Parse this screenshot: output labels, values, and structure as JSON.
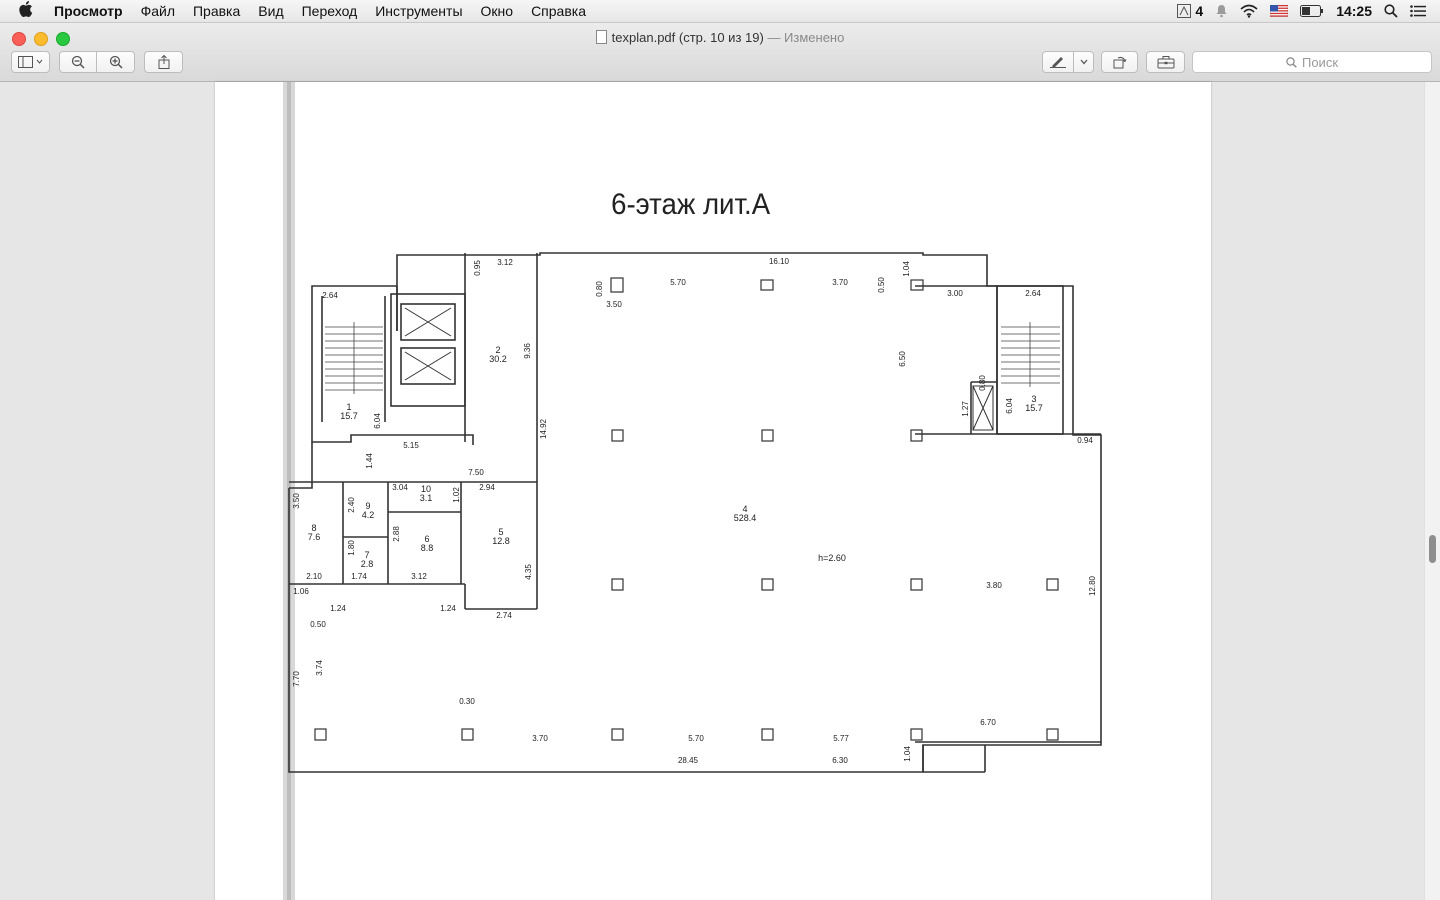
{
  "menubar": {
    "apple_label": "",
    "app_name": "Просмотр",
    "items": [
      "Файл",
      "Правка",
      "Вид",
      "Переход",
      "Инструменты",
      "Окно",
      "Справка"
    ],
    "status_count": "4",
    "clock": "14:25"
  },
  "window": {
    "filename": "texplan.pdf (стр. 10 из 19)",
    "status": "— Изменено",
    "search_placeholder": "Поиск"
  },
  "plan": {
    "title": "6-этаж лит.А",
    "rooms": [
      {
        "num": "1",
        "area": "15.7"
      },
      {
        "num": "2",
        "area": "30.2"
      },
      {
        "num": "3",
        "area": "15.7"
      },
      {
        "num": "4",
        "area": "528.4"
      },
      {
        "num": "5",
        "area": "12.8"
      },
      {
        "num": "6",
        "area": "8.8"
      },
      {
        "num": "7",
        "area": "2.8"
      },
      {
        "num": "8",
        "area": "7.6"
      },
      {
        "num": "9",
        "area": "4.2"
      },
      {
        "num": "10",
        "area": "3.1"
      }
    ],
    "height_note": "h=2.60",
    "dimensions": {
      "d_3_12": "3.12",
      "d_0_95": "0.95",
      "d_16_10": "16.10",
      "d_1_04a": "1.04",
      "d_0_80a": "0.80",
      "d_5_70a": "5.70",
      "d_3_70a": "3.70",
      "d_0_50a": "0.50",
      "d_3_50": "3.50",
      "d_3_00": "3.00",
      "d_2_64a": "2.64",
      "d_2_64b": "2.64",
      "d_9_36": "9.36",
      "d_6_50": "6.50",
      "d_0_80b": "0.80",
      "d_1_27": "1.27",
      "d_6_04a": "6.04",
      "d_6_04b": "6.04",
      "d_14_92": "14.92",
      "d_5_15": "5.15",
      "d_0_94": "0.94",
      "d_1_44": "1.44",
      "d_7_50": "7.50",
      "d_3_04": "3.04",
      "d_1_02": "1.02",
      "d_2_94": "2.94",
      "d_3_50b": "3.50",
      "d_2_40": "2.40",
      "d_2_88": "2.88",
      "d_1_80": "1.80",
      "d_4_35": "4.35",
      "d_2_10": "2.10",
      "d_1_74": "1.74",
      "d_3_12b": "3.12",
      "d_3_80": "3.80",
      "d_12_80": "12.80",
      "d_1_06": "1.06",
      "d_1_24a": "1.24",
      "d_1_24b": "1.24",
      "d_2_74": "2.74",
      "d_0_50b": "0.50",
      "d_3_74": "3.74",
      "d_7_70": "7.70",
      "d_0_30": "0.30",
      "d_3_70b": "3.70",
      "d_5_70b": "5.70",
      "d_5_77": "5.77",
      "d_6_70": "6.70",
      "d_28_45": "28.45",
      "d_6_30": "6.30",
      "d_1_04b": "1.04"
    }
  }
}
